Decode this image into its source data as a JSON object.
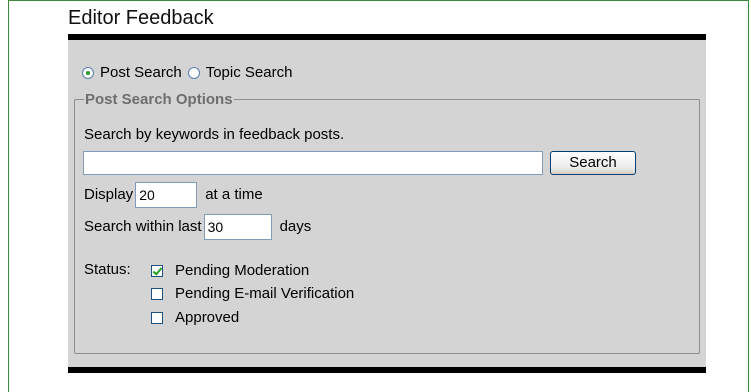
{
  "page": {
    "title": "Editor Feedback"
  },
  "search_type": {
    "options": [
      {
        "label": "Post Search",
        "selected": true
      },
      {
        "label": "Topic Search",
        "selected": false
      }
    ]
  },
  "post_search_options": {
    "legend": "Post Search Options",
    "description": "Search by keywords in feedback posts.",
    "keywords_value": "",
    "search_button": "Search",
    "display": {
      "prefix": "Display",
      "value": "20",
      "suffix": "at a time"
    },
    "within": {
      "prefix": "Search within last",
      "value": "30",
      "suffix": "days"
    },
    "status": {
      "label": "Status:",
      "options": [
        {
          "label": "Pending Moderation",
          "checked": true
        },
        {
          "label": "Pending E-mail Verification",
          "checked": false
        },
        {
          "label": "Approved",
          "checked": false
        }
      ]
    }
  }
}
